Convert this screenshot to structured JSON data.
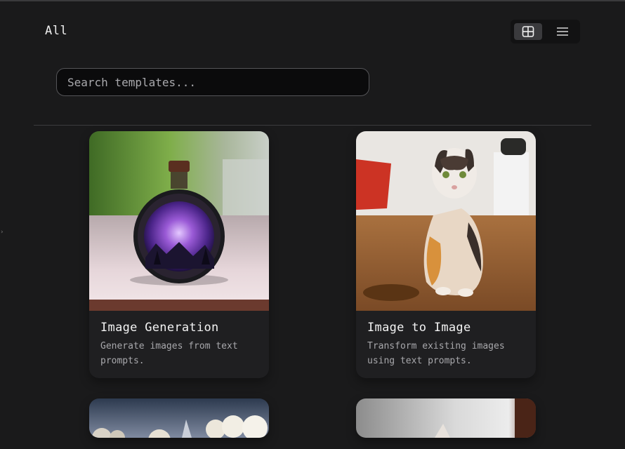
{
  "header": {
    "title": "All"
  },
  "view_toggle": {
    "active": "grid",
    "icons": [
      "grid-icon",
      "list-icon"
    ]
  },
  "search": {
    "placeholder": "Search templates..."
  },
  "templates": [
    {
      "title": "Image Generation",
      "description": "Generate images from text prompts."
    },
    {
      "title": "Image to Image",
      "description": "Transform existing images using text prompts."
    }
  ],
  "colors": {
    "background": "#1a1a1b",
    "card": "#1f1f21",
    "accent_toggle": "#3a3a3d"
  }
}
